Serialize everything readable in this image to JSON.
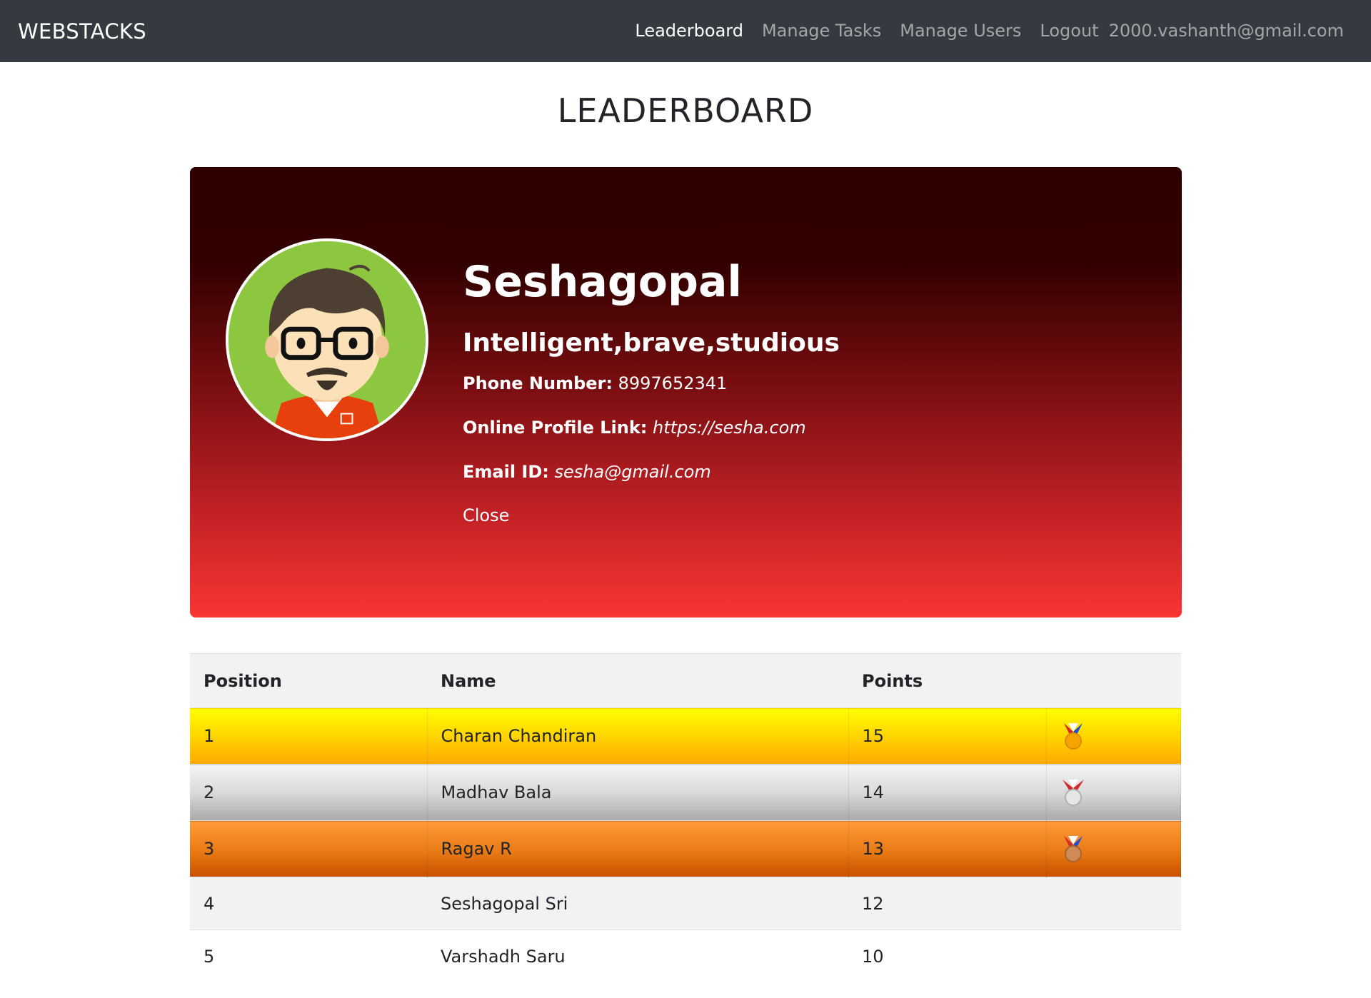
{
  "navbar": {
    "brand": "WEBSTACKS",
    "links": [
      {
        "label": "Leaderboard",
        "active": true
      },
      {
        "label": "Manage Tasks",
        "active": false
      },
      {
        "label": "Manage Users",
        "active": false
      },
      {
        "label": "Logout",
        "active": false
      }
    ],
    "user_email": "2000.vashanth@gmail.com"
  },
  "page": {
    "title": "LEADERBOARD"
  },
  "profile": {
    "name": "Seshagopal",
    "traits": "Intelligent,brave,studious",
    "phone_label": "Phone Number:",
    "phone": "8997652341",
    "profile_link_label": "Online Profile Link:",
    "profile_link": "https://sesha.com",
    "email_label": "Email ID:",
    "email": "sesha@gmail.com",
    "close_label": "Close",
    "avatar_icon": "cartoon-avatar-icon"
  },
  "leaderboard": {
    "columns": [
      "Position",
      "Name",
      "Points",
      ""
    ],
    "rows": [
      {
        "position": "1",
        "name": "Charan Chandiran",
        "points": "15",
        "medal": "gold-medal-icon"
      },
      {
        "position": "2",
        "name": "Madhav Bala",
        "points": "14",
        "medal": "silver-medal-icon"
      },
      {
        "position": "3",
        "name": "Ragav R",
        "points": "13",
        "medal": "bronze-medal-icon"
      },
      {
        "position": "4",
        "name": "Seshagopal Sri",
        "points": "12",
        "medal": ""
      },
      {
        "position": "5",
        "name": "Varshadh Saru",
        "points": "10",
        "medal": ""
      }
    ]
  },
  "colors": {
    "navbar_bg": "#343a40",
    "gold": "#ffd000",
    "silver": "#d9d9d9",
    "bronze": "#e87a15",
    "card_top": "#330000",
    "card_bottom": "#f93535"
  }
}
